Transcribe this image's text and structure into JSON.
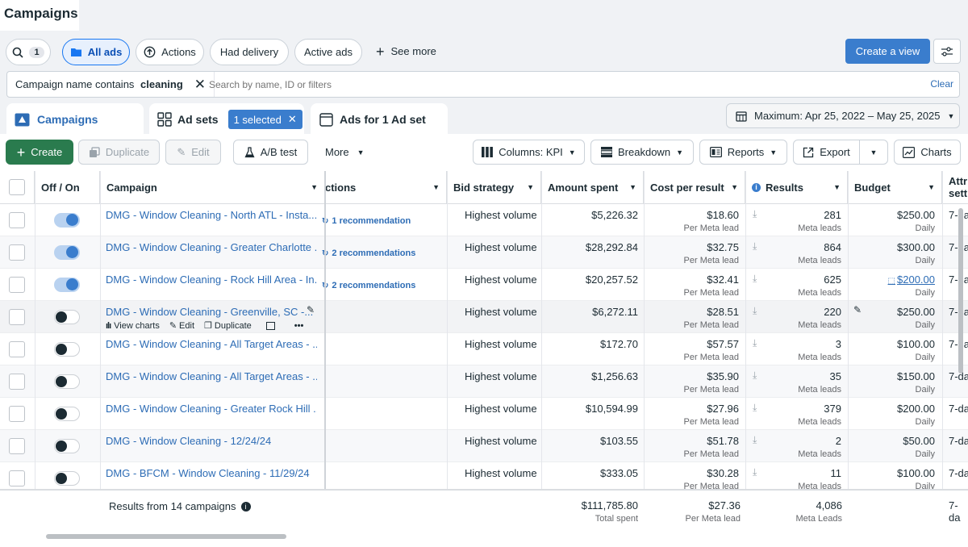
{
  "app": {
    "title": "Campaigns"
  },
  "toolbar": {
    "search_count": "1",
    "all_ads": "All ads",
    "actions": "Actions",
    "had_delivery": "Had delivery",
    "active_ads": "Active ads",
    "see_more": "See more",
    "create_view": "Create a view"
  },
  "filter": {
    "chip_prefix": "Campaign name contains ",
    "chip_value": "cleaning",
    "placeholder": "Search by name, ID or filters",
    "clear": "Clear"
  },
  "tabs": {
    "campaigns": "Campaigns",
    "ad_sets": "Ad sets",
    "selected": "1 selected",
    "ads": "Ads for 1 Ad set"
  },
  "date_range": "Maximum: Apr 25, 2022 – May 25, 2025",
  "actions": {
    "create": "Create",
    "duplicate": "Duplicate",
    "edit": "Edit",
    "ab_test": "A/B test",
    "more": "More",
    "columns": "Columns: KPI",
    "breakdown": "Breakdown",
    "reports": "Reports",
    "export": "Export",
    "charts": "Charts"
  },
  "columns": {
    "off_on": "Off / On",
    "campaign": "Campaign",
    "actions": "ctions",
    "bid_strategy": "Bid strategy",
    "amount_spent": "Amount spent",
    "cost_per_result": "Cost per result",
    "results": "Results",
    "budget": "Budget",
    "attr1": "Attr",
    "attr2": "sett"
  },
  "rows": [
    {
      "name": "DMG - Window Cleaning - North ATL - Insta...",
      "on": true,
      "rec": "1 recommendation",
      "bid": "Highest volume",
      "spent": "$5,226.32",
      "cpr": "$18.60",
      "cpr_sub": "Per Meta lead",
      "results": "281",
      "results_sub": "Meta leads",
      "budget": "$250.00",
      "budget_sub": "Daily",
      "attr": "7-da"
    },
    {
      "name": "DMG - Window Cleaning - Greater Charlotte ...",
      "on": true,
      "rec": "2 recommendations",
      "bid": "Highest volume",
      "spent": "$28,292.84",
      "cpr": "$32.75",
      "cpr_sub": "Per Meta lead",
      "results": "864",
      "results_sub": "Meta leads",
      "budget": "$300.00",
      "budget_sub": "Daily",
      "attr": "7-da"
    },
    {
      "name": "DMG - Window Cleaning - Rock Hill Area - In...",
      "on": true,
      "rec": "2 recommendations",
      "bid": "Highest volume",
      "spent": "$20,257.52",
      "cpr": "$32.41",
      "cpr_sub": "Per Meta lead",
      "results": "625",
      "results_sub": "Meta leads",
      "budget": "$200.00",
      "budget_sub": "Daily",
      "attr": "7-da"
    },
    {
      "name": "DMG - Window Cleaning - Greenville, SC -...",
      "on": false,
      "rec": "",
      "bid": "Highest volume",
      "spent": "$6,272.11",
      "cpr": "$28.51",
      "cpr_sub": "Per Meta lead",
      "results": "220",
      "results_sub": "Meta leads",
      "budget": "$250.00",
      "budget_sub": "Daily",
      "attr": "7-da"
    },
    {
      "name": "DMG - Window Cleaning - All Target Areas - ...",
      "on": false,
      "rec": "",
      "bid": "Highest volume",
      "spent": "$172.70",
      "cpr": "$57.57",
      "cpr_sub": "Per Meta lead",
      "results": "3",
      "results_sub": "Meta leads",
      "budget": "$100.00",
      "budget_sub": "Daily",
      "attr": "7-da"
    },
    {
      "name": "DMG - Window Cleaning - All Target Areas - ...",
      "on": false,
      "rec": "",
      "bid": "Highest volume",
      "spent": "$1,256.63",
      "cpr": "$35.90",
      "cpr_sub": "Per Meta lead",
      "results": "35",
      "results_sub": "Meta leads",
      "budget": "$150.00",
      "budget_sub": "Daily",
      "attr": "7-da"
    },
    {
      "name": "DMG - Window Cleaning - Greater Rock Hill ...",
      "on": false,
      "rec": "",
      "bid": "Highest volume",
      "spent": "$10,594.99",
      "cpr": "$27.96",
      "cpr_sub": "Per Meta lead",
      "results": "379",
      "results_sub": "Meta leads",
      "budget": "$200.00",
      "budget_sub": "Daily",
      "attr": "7-da"
    },
    {
      "name": "DMG - Window Cleaning - 12/24/24",
      "on": false,
      "rec": "",
      "bid": "Highest volume",
      "spent": "$103.55",
      "cpr": "$51.78",
      "cpr_sub": "Per Meta lead",
      "results": "2",
      "results_sub": "Meta leads",
      "budget": "$50.00",
      "budget_sub": "Daily",
      "attr": "7-da"
    },
    {
      "name": "DMG - BFCM - Window Cleaning - 11/29/24",
      "on": false,
      "rec": "",
      "bid": "Highest volume",
      "spent": "$333.05",
      "cpr": "$30.28",
      "cpr_sub": "Per Meta lead",
      "results": "11",
      "results_sub": "Meta leads",
      "budget": "$100.00",
      "budget_sub": "Daily",
      "attr": "7-da"
    }
  ],
  "row_actions": {
    "view_charts": "View charts",
    "edit": "Edit",
    "duplicate": "Duplicate"
  },
  "footer": {
    "label": "Results from 14 campaigns",
    "spent": "$111,785.80",
    "spent_sub": "Total spent",
    "cpr": "$27.36",
    "cpr_sub": "Per Meta lead",
    "results": "4,086",
    "results_sub": "Meta Leads",
    "attr": "7-da"
  }
}
